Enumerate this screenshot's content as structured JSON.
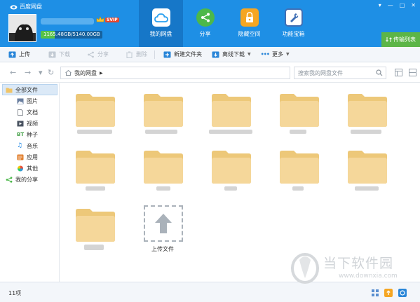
{
  "app": {
    "title": "百度网盘"
  },
  "user": {
    "vip_badge": "SVIP",
    "quota_text": "1165.48GB/5140.00GB",
    "quota_used_fraction": 0.2267
  },
  "nav": {
    "tabs": [
      {
        "label": "我的网盘",
        "icon": "cloud-icon",
        "color": "#2aa0ef",
        "active": true
      },
      {
        "label": "分享",
        "icon": "share-icon",
        "color": "#4cb84a",
        "active": false
      },
      {
        "label": "隐藏空间",
        "icon": "lock-icon",
        "color": "#f5a623",
        "active": false
      },
      {
        "label": "功能宝箱",
        "icon": "wrench-icon",
        "color": "#3f6fb5",
        "active": false
      }
    ]
  },
  "window": {
    "controls": [
      "▾",
      "—",
      "□",
      "✕"
    ]
  },
  "transfer": {
    "label": "传输列表"
  },
  "toolbar": {
    "upload": "上传",
    "download": "下载",
    "share": "分享",
    "delete": "删除",
    "new_folder": "新建文件夹",
    "offline_download": "离线下载",
    "more": "更多"
  },
  "address": {
    "breadcrumb": "我的网盘",
    "search_placeholder": "搜索我的网盘文件"
  },
  "sidebar": {
    "all_files": "全部文件",
    "items": [
      {
        "label": "图片",
        "icon": "image-icon",
        "color": "#6a7fa0"
      },
      {
        "label": "文档",
        "icon": "document-icon",
        "color": "#8a8f96"
      },
      {
        "label": "视频",
        "icon": "video-icon",
        "color": "#4a5361"
      },
      {
        "label": "种子",
        "icon": "bt-icon",
        "color": "#43a047"
      },
      {
        "label": "音乐",
        "icon": "music-icon",
        "color": "#1e88e5"
      },
      {
        "label": "应用",
        "icon": "app-icon",
        "color": "#e07b26"
      },
      {
        "label": "其他",
        "icon": "other-icon",
        "color": "#d65a6a"
      }
    ],
    "my_share": "我的分享"
  },
  "files": {
    "upload_tile_label": "上传文件"
  },
  "status": {
    "count": "11项"
  },
  "watermark": {
    "text": "当下软件园",
    "url": "www.downxia.com"
  },
  "colors": {
    "header": "#1e8fe5",
    "header_active": "#1677c8",
    "folder_body": "#f5d79a",
    "folder_tab": "#edc879",
    "transfer_green": "#5cb547"
  }
}
